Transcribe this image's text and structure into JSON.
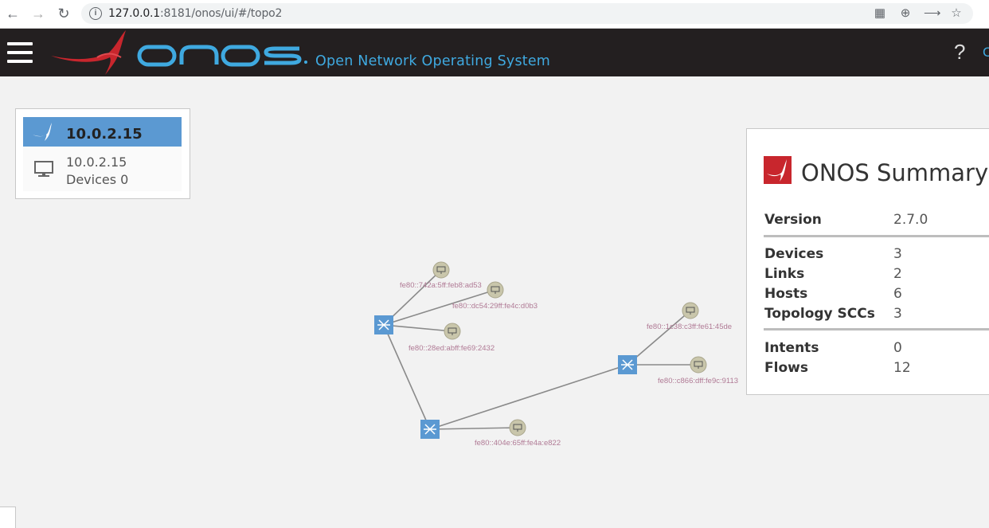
{
  "browser": {
    "url_host": "127.0.0.1",
    "url_rest": ":8181/onos/ui/#/topo2"
  },
  "header": {
    "brand": "onos",
    "subtitle": "Open Network Operating System",
    "help_label": "?"
  },
  "instance": {
    "title": "10.0.2.15",
    "ip": "10.0.2.15",
    "devices": "Devices 0"
  },
  "summary": {
    "title": "ONOS Summary",
    "rows": [
      {
        "key": "Version",
        "value": "2.7.0"
      },
      {
        "key": "Devices",
        "value": "3"
      },
      {
        "key": "Links",
        "value": "2"
      },
      {
        "key": "Hosts",
        "value": "6"
      },
      {
        "key": "Topology SCCs",
        "value": "3"
      },
      {
        "key": "Intents",
        "value": "0"
      },
      {
        "key": "Flows",
        "value": "12"
      }
    ]
  },
  "topology": {
    "hosts": [
      {
        "label": "fe80::742a:5ff:feb8:ad53"
      },
      {
        "label": "fe80::dc54:29ff:fe4c:d0b3"
      },
      {
        "label": "fe80::28ed:abff:fe69:2432"
      },
      {
        "label": "fe80::1c38:c3ff:fe61:45de"
      },
      {
        "label": "fe80::c866:dff:fe9c:9113"
      },
      {
        "label": "fe80::404e:65ff:fe4a:e822"
      }
    ]
  },
  "colors": {
    "masthead": "#231f20",
    "accent_blue": "#3fa9e0",
    "switch_blue": "#5b99d2",
    "onos_red": "#c8262d",
    "host_label": "#b07a95"
  }
}
